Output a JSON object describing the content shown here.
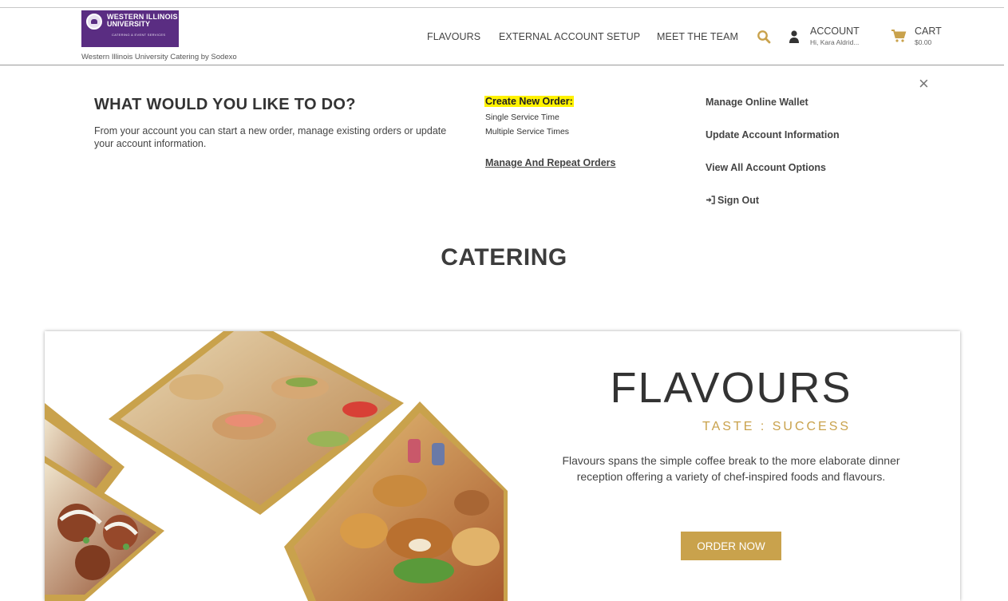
{
  "header": {
    "logo": {
      "line1": "WESTERN ILLINOIS",
      "line2": "UNIVERSITY",
      "line3": "CATERING & EVENT SERVICES",
      "brand_color": "#5a2d82"
    },
    "site_tagline": "Western Illinois University Catering by Sodexo",
    "nav": {
      "flavours": "FLAVOURS",
      "external_account_setup": "EXTERNAL ACCOUNT SETUP",
      "meet_the_team": "MEET THE TEAM"
    },
    "search_icon": "search-icon",
    "account": {
      "label": "ACCOUNT",
      "sub": "Hi, Kara Aldrid..."
    },
    "cart": {
      "label": "CART",
      "sub": "$0.00"
    },
    "accent_color": "#c9a24c"
  },
  "account_panel": {
    "title": "WHAT WOULD YOU LIKE TO DO?",
    "description": "From your account you can start a new order, manage existing orders or update your account information.",
    "create_new_order": "Create New Order:",
    "single_service_time": "Single Service Time",
    "multiple_service_times": "Multiple Service Times",
    "manage_and_repeat_orders": "Manage And Repeat Orders",
    "manage_online_wallet": "Manage Online Wallet",
    "update_account_information": "Update Account Information",
    "view_all_account_options": "View All Account Options",
    "sign_out": "Sign Out",
    "close": "×"
  },
  "main": {
    "section_title": "CATERING",
    "promo": {
      "brand": "FLAVOURS",
      "tagline": "TASTE : SUCCESS",
      "description": "Flavours spans the simple coffee break to the more elaborate dinner reception offering a variety of chef-inspired foods and flavours.",
      "button": "ORDER NOW"
    }
  }
}
